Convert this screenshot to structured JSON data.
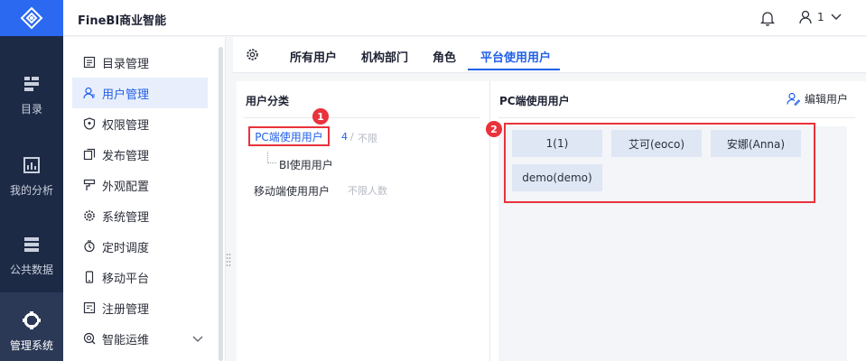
{
  "app": {
    "title": "FineBI商业智能"
  },
  "header": {
    "user_name": "1"
  },
  "rail": {
    "items": [
      {
        "label": "目录",
        "icon": "catalog-icon"
      },
      {
        "label": "我的分析",
        "icon": "analysis-icon"
      },
      {
        "label": "公共数据",
        "icon": "public-data-icon"
      },
      {
        "label": "管理系统",
        "icon": "management-icon",
        "active": true
      }
    ]
  },
  "submenu": {
    "items": [
      {
        "label": "目录管理",
        "icon": "catalog-manage-icon"
      },
      {
        "label": "用户管理",
        "icon": "user-manage-icon",
        "active": true
      },
      {
        "label": "权限管理",
        "icon": "permission-icon"
      },
      {
        "label": "发布管理",
        "icon": "publish-icon"
      },
      {
        "label": "外观配置",
        "icon": "appearance-icon"
      },
      {
        "label": "系统管理",
        "icon": "system-icon"
      },
      {
        "label": "定时调度",
        "icon": "schedule-icon"
      },
      {
        "label": "移动平台",
        "icon": "mobile-icon"
      },
      {
        "label": "注册管理",
        "icon": "register-icon"
      },
      {
        "label": "智能运维",
        "icon": "ops-icon"
      }
    ]
  },
  "tabs": [
    {
      "label": "所有用户"
    },
    {
      "label": "机构部门"
    },
    {
      "label": "角色"
    },
    {
      "label": "平台使用用户",
      "active": true
    }
  ],
  "left_panel": {
    "title": "用户分类",
    "categories": {
      "pc_label": "PC端使用用户",
      "pc_count": "4",
      "pc_sep": "/",
      "pc_limit": "不限",
      "bi_label": "BI使用用户",
      "mobile_label": "移动端使用用户",
      "mobile_limit": "不限人数"
    }
  },
  "right_panel": {
    "title": "PC端使用用户",
    "edit_label": "编辑用户",
    "users": [
      "1(1)",
      "艾可(eoco)",
      "安娜(Anna)",
      "demo(demo)"
    ]
  },
  "annotations": {
    "badge_1": "1",
    "badge_2": "2"
  },
  "colors": {
    "accent": "#2160e9",
    "highlight": "#e9323c",
    "rail_bg": "#1d2a45",
    "logo_bg": "#2a69f0"
  }
}
